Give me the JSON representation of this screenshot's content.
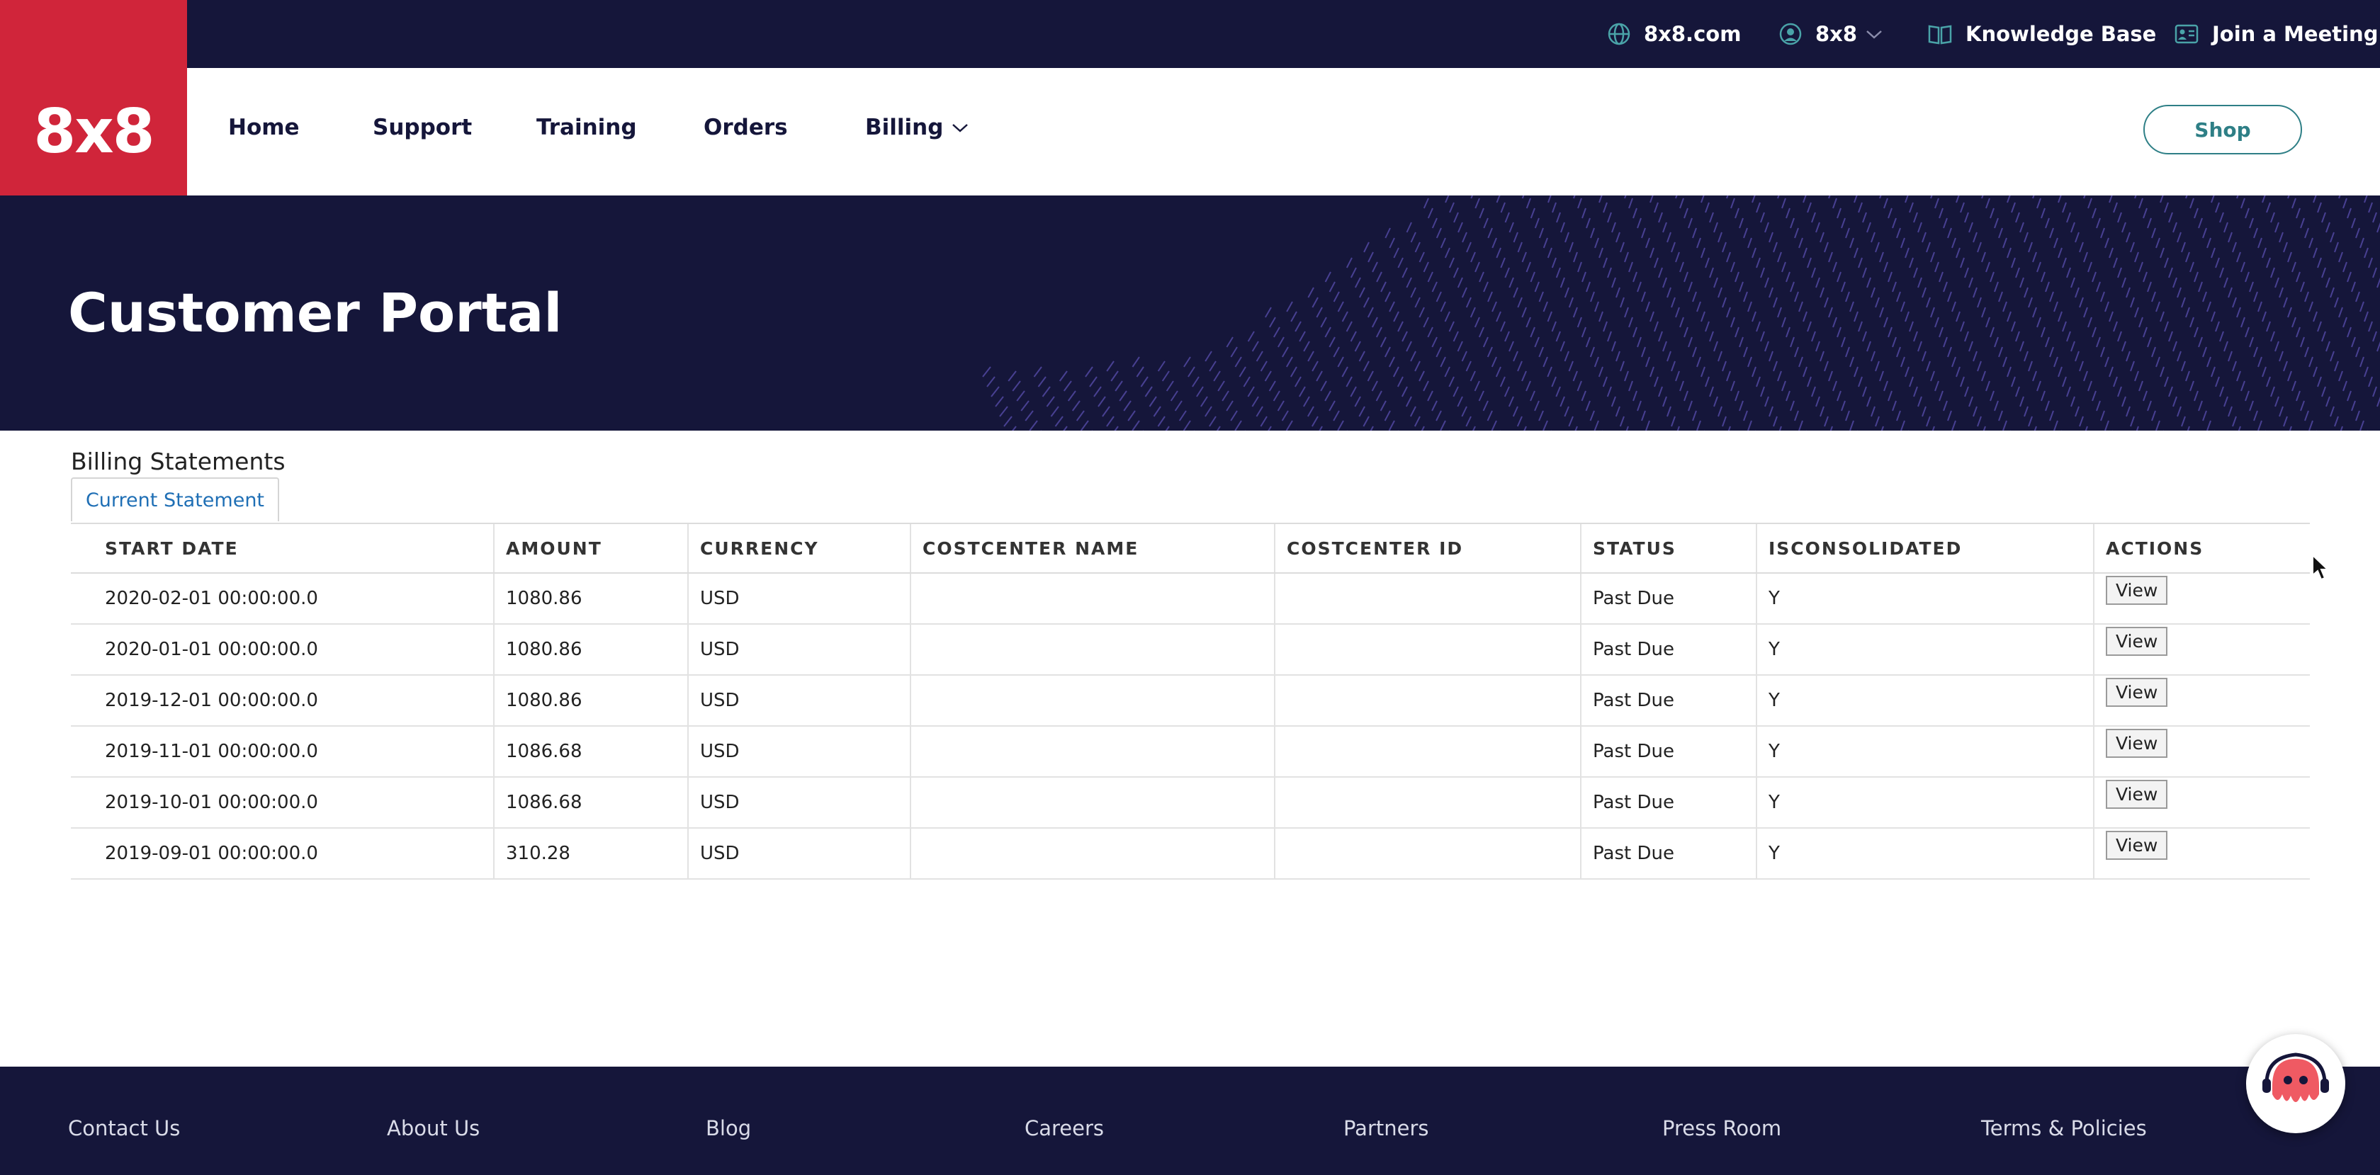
{
  "topbar": {
    "site_link": "8x8.com",
    "account_label": "8x8",
    "knowledge_base": "Knowledge Base",
    "join_meeting": "Join a Meeting"
  },
  "logo": {
    "text": "8x8"
  },
  "nav": {
    "items": [
      "Home",
      "Support",
      "Training",
      "Orders",
      "Billing"
    ],
    "shop_label": "Shop"
  },
  "hero": {
    "title": "Customer Portal"
  },
  "billing": {
    "section_title": "Billing Statements",
    "tab_label": "Current Statement",
    "columns": [
      "START DATE",
      "AMOUNT",
      "CURRENCY",
      "COSTCENTER NAME",
      "COSTCENTER ID",
      "STATUS",
      "ISCONSOLIDATED",
      "ACTIONS"
    ],
    "rows": [
      {
        "start_date": "2020-02-01 00:00:00.0",
        "amount": "1080.86",
        "currency": "USD",
        "costcenter_name": "",
        "costcenter_id": "",
        "status": "Past Due",
        "isconsolidated": "Y",
        "action": "View"
      },
      {
        "start_date": "2020-01-01 00:00:00.0",
        "amount": "1080.86",
        "currency": "USD",
        "costcenter_name": "",
        "costcenter_id": "",
        "status": "Past Due",
        "isconsolidated": "Y",
        "action": "View"
      },
      {
        "start_date": "2019-12-01 00:00:00.0",
        "amount": "1080.86",
        "currency": "USD",
        "costcenter_name": "",
        "costcenter_id": "",
        "status": "Past Due",
        "isconsolidated": "Y",
        "action": "View"
      },
      {
        "start_date": "2019-11-01 00:00:00.0",
        "amount": "1086.68",
        "currency": "USD",
        "costcenter_name": "",
        "costcenter_id": "",
        "status": "Past Due",
        "isconsolidated": "Y",
        "action": "View"
      },
      {
        "start_date": "2019-10-01 00:00:00.0",
        "amount": "1086.68",
        "currency": "USD",
        "costcenter_name": "",
        "costcenter_id": "",
        "status": "Past Due",
        "isconsolidated": "Y",
        "action": "View"
      },
      {
        "start_date": "2019-09-01 00:00:00.0",
        "amount": "310.28",
        "currency": "USD",
        "costcenter_name": "",
        "costcenter_id": "",
        "status": "Past Due",
        "isconsolidated": "Y",
        "action": "View"
      }
    ]
  },
  "footer": {
    "links": [
      "Contact Us",
      "About Us",
      "Blog",
      "Careers",
      "Partners",
      "Press Room",
      "Terms & Policies"
    ]
  },
  "icons": {
    "globe": "globe-icon",
    "user": "user-circle-icon",
    "book": "book-icon",
    "meeting": "meeting-icon",
    "chevron": "chevron-down-icon",
    "chatbot": "octopus-chatbot-icon"
  },
  "colors": {
    "navy": "#15163a",
    "brand_red": "#d0253a",
    "teal": "#2e7f86",
    "link_blue": "#1f6fb5"
  }
}
